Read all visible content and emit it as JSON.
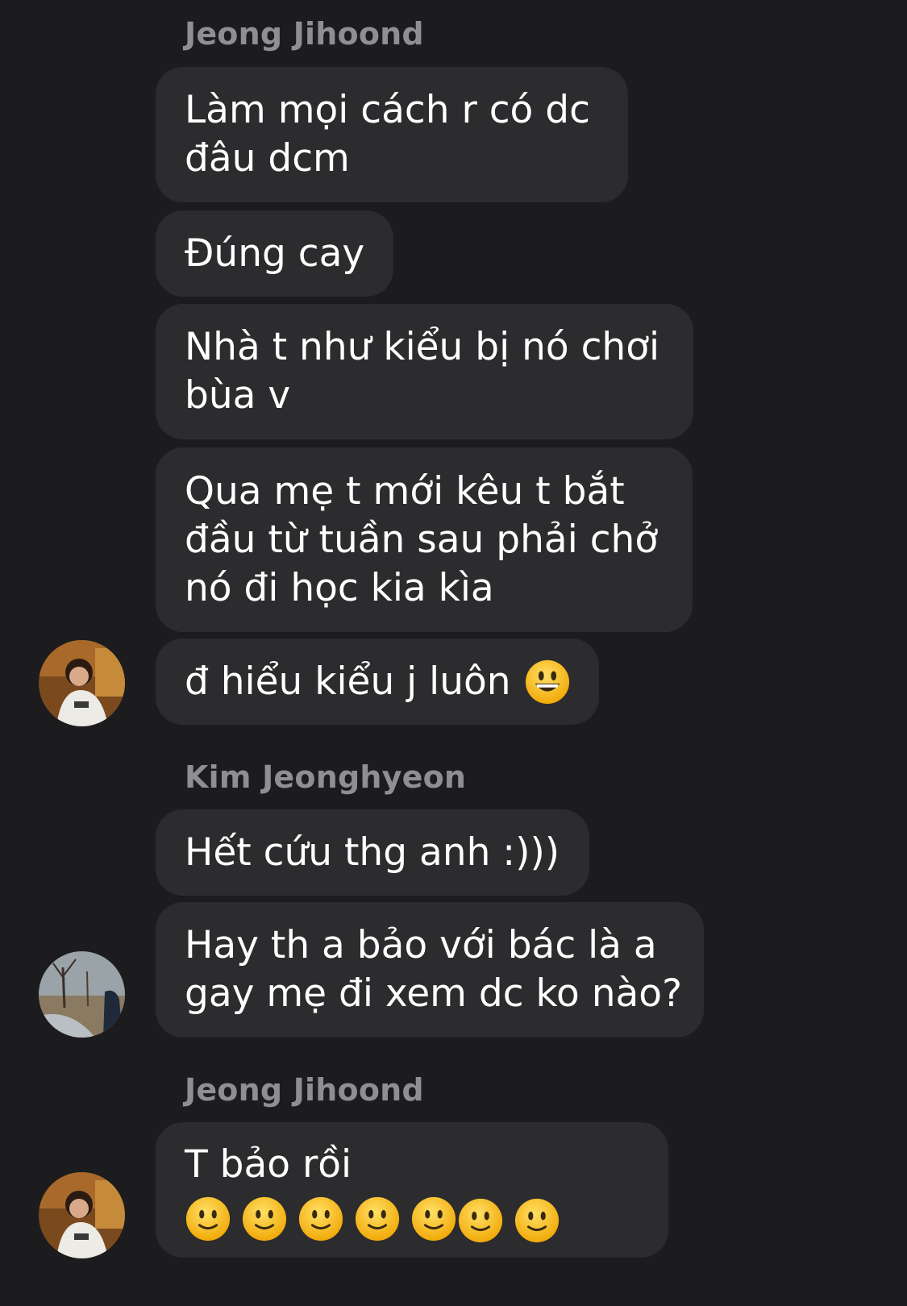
{
  "messages": {
    "group1_sender": "Jeong Jihoond",
    "m1": "Làm mọi cách r có dc\nđâu dcm",
    "m2": "Đúng cay",
    "m3": "Nhà t như kiểu bị nó chơi\nbùa v",
    "m4": "Qua mẹ t mới kêu t bắt\nđầu từ tuần sau phải chở\nnó đi học kia kìa",
    "m5": "đ hiểu kiểu j luôn",
    "group2_sender": "Kim Jeonghyeon",
    "m6": "Hết cứu thg anh :)))",
    "m7": "Hay th a bảo với bác là a\ngay mẹ đi xem dc ko nào?",
    "group3_sender": "Jeong Jihoond",
    "m8": "T bảo rồi"
  },
  "emojis": {
    "m5": "grinning-face",
    "m8": "slightly-smiling-face"
  },
  "colors": {
    "background": "#1c1c1e",
    "bubble": "#2c2c2e",
    "sender_name": "#8e8e93",
    "text": "#ffffff"
  }
}
